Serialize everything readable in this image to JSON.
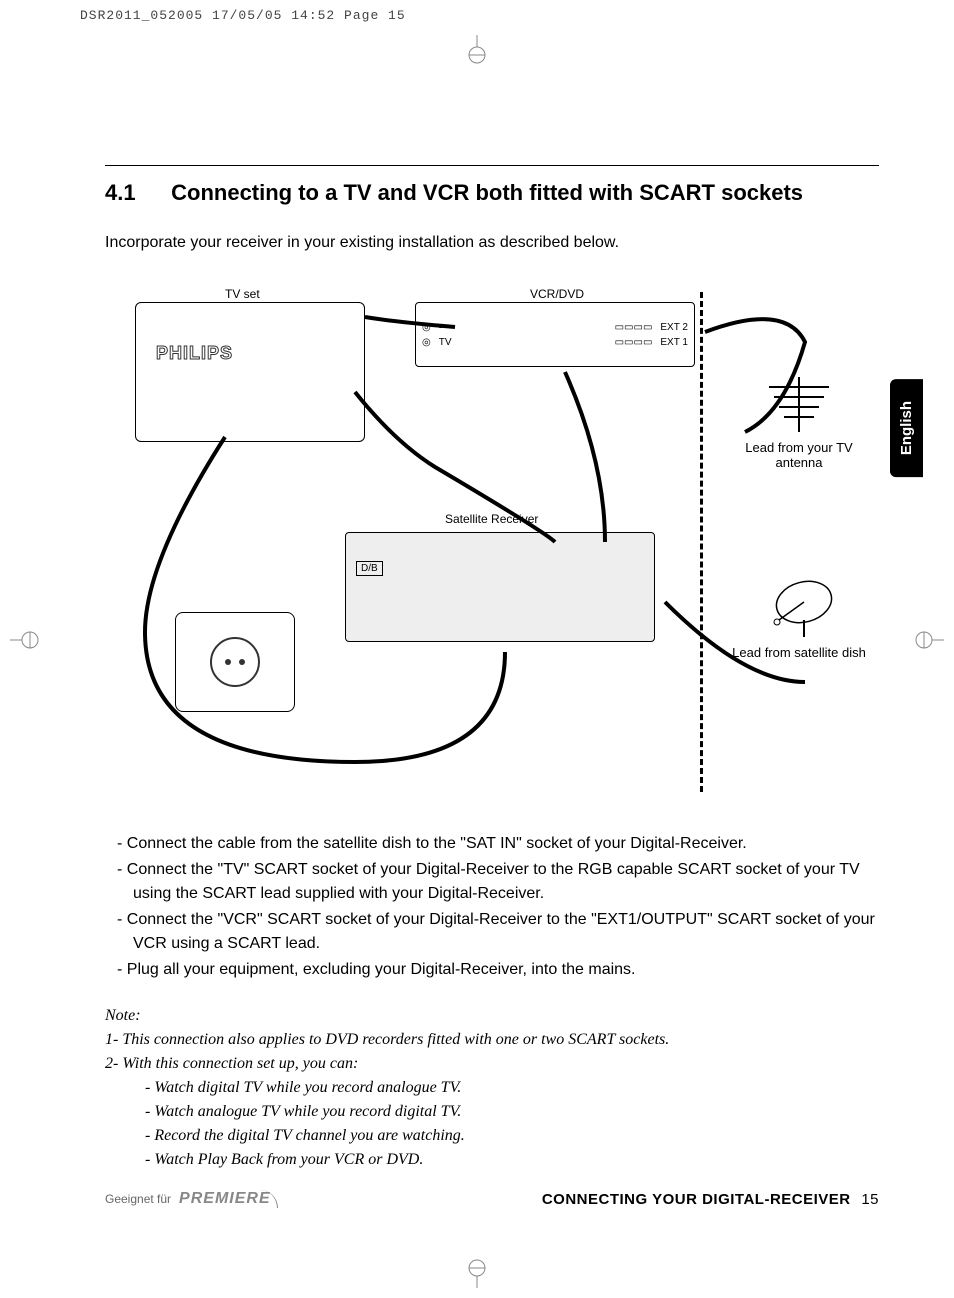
{
  "print_header": "DSR2011_052005  17/05/05  14:52  Page 15",
  "section": {
    "number": "4.1",
    "title": "Connecting to a TV and VCR both fitted with SCART sockets"
  },
  "intro": "Incorporate your receiver in your existing installation as described below.",
  "lang_tab": "English",
  "diagram": {
    "tv_label": "TV set",
    "tv_brand": "PHILIPS",
    "vcr_label": "VCR/DVD",
    "vcr_tv_port": "TV",
    "vcr_ext1": "EXT 1",
    "vcr_ext2": "EXT 2",
    "receiver_label": "Satellite Receiver",
    "receiver_badge": "D/B",
    "antenna_text": "Lead from your TV antenna",
    "dish_text": "Lead from satellite dish"
  },
  "bullets": [
    "Connect the cable from the satellite dish to the \"SAT IN\" socket of your Digital-Receiver.",
    "Connect the \"TV\" SCART socket of your Digital-Receiver to the RGB capable SCART socket of your TV using the SCART lead supplied with your Digital-Receiver.",
    "Connect the \"VCR\" SCART socket of your Digital-Receiver to the \"EXT1/OUTPUT\" SCART socket of your VCR using a SCART lead.",
    "Plug all your equipment, excluding your Digital-Receiver, into the mains."
  ],
  "note": {
    "label": "Note:",
    "n1": "1- This connection also applies to DVD recorders fitted with one or two SCART sockets.",
    "n2": "2- With this connection set up, you can:",
    "subs": [
      "- Watch digital TV while you record analogue TV.",
      "- Watch analogue TV while you record digital TV.",
      "- Record the digital TV channel you are watching.",
      "- Watch Play Back from your VCR or DVD."
    ]
  },
  "footer": {
    "geeignet": "Geeignet für",
    "premiere": "PREMIERE",
    "title": "CONNECTING YOUR DIGITAL-RECEIVER",
    "page": "15"
  }
}
